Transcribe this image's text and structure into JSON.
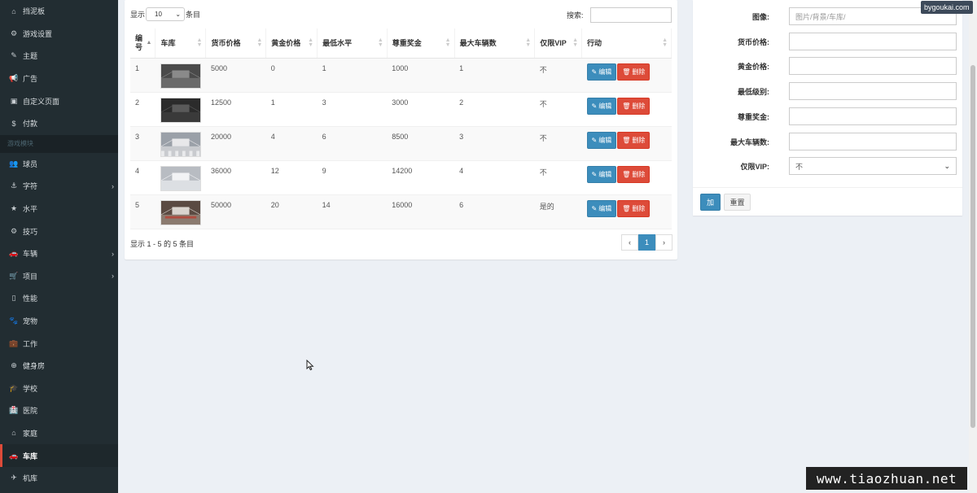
{
  "sidebar": {
    "items": [
      {
        "icon": "home-icon",
        "glyph": "⌂",
        "label": "挡泥板",
        "chevron": false
      },
      {
        "icon": "cogs-icon",
        "glyph": "⚙",
        "label": "游戏设置",
        "chevron": false
      },
      {
        "icon": "brush-icon",
        "glyph": "✎",
        "label": "主题",
        "chevron": false
      },
      {
        "icon": "bullhorn-icon",
        "glyph": "📢",
        "label": "广告",
        "chevron": false
      },
      {
        "icon": "window-icon",
        "glyph": "▣",
        "label": "自定义页面",
        "chevron": false
      },
      {
        "icon": "dollar-icon",
        "glyph": "$",
        "label": "付款",
        "chevron": false
      }
    ],
    "section_header": "游戏模块",
    "game_items": [
      {
        "icon": "users-icon",
        "glyph": "👥",
        "label": "球员",
        "chevron": false
      },
      {
        "icon": "anchor-icon",
        "glyph": "⚓",
        "label": "字符",
        "chevron": true
      },
      {
        "icon": "star-icon",
        "glyph": "★",
        "label": "水平",
        "chevron": false
      },
      {
        "icon": "gear-icon",
        "glyph": "⚙",
        "label": "技巧",
        "chevron": false
      },
      {
        "icon": "car-icon",
        "glyph": "🚗",
        "label": "车辆",
        "chevron": true
      },
      {
        "icon": "cart-icon",
        "glyph": "🛒",
        "label": "项目",
        "chevron": true
      },
      {
        "icon": "mobile-icon",
        "glyph": "▯",
        "label": "性能",
        "chevron": false
      },
      {
        "icon": "paw-icon",
        "glyph": "🐾",
        "label": "宠物",
        "chevron": false
      },
      {
        "icon": "briefcase-icon",
        "glyph": "💼",
        "label": "工作",
        "chevron": false
      },
      {
        "icon": "dumbbell-icon",
        "glyph": "⊕",
        "label": "健身房",
        "chevron": false
      },
      {
        "icon": "graduation-cap-icon",
        "glyph": "🎓",
        "label": "学校",
        "chevron": false
      },
      {
        "icon": "hospital-icon",
        "glyph": "🏥",
        "label": "医院",
        "chevron": false
      },
      {
        "icon": "house-icon",
        "glyph": "⌂",
        "label": "家庭",
        "chevron": false
      },
      {
        "icon": "car-icon",
        "glyph": "🚗",
        "label": "车库",
        "chevron": false,
        "active": true
      },
      {
        "icon": "plane-icon",
        "glyph": "✈",
        "label": "机库",
        "chevron": false
      }
    ]
  },
  "table_box": {
    "show_label": "显示",
    "page_length": "10",
    "entries_label": "条目",
    "search_label": "搜索:",
    "columns": [
      "编号",
      "车库",
      "货币价格",
      "黄金价格",
      "最低水平",
      "尊重奖金",
      "最大车辆数",
      "仅限VIP",
      "行动"
    ],
    "rows": [
      {
        "id": "1",
        "money": "5000",
        "gold": "0",
        "level": "1",
        "respect": "1000",
        "max_cars": "1",
        "vip": "不"
      },
      {
        "id": "2",
        "money": "12500",
        "gold": "1",
        "level": "3",
        "respect": "3000",
        "max_cars": "2",
        "vip": "不"
      },
      {
        "id": "3",
        "money": "20000",
        "gold": "4",
        "level": "6",
        "respect": "8500",
        "max_cars": "3",
        "vip": "不"
      },
      {
        "id": "4",
        "money": "36000",
        "gold": "12",
        "level": "9",
        "respect": "14200",
        "max_cars": "4",
        "vip": "不"
      },
      {
        "id": "5",
        "money": "50000",
        "gold": "20",
        "level": "14",
        "respect": "16000",
        "max_cars": "6",
        "vip": "是的"
      }
    ],
    "edit_label": "编辑",
    "delete_label": "删除",
    "info": "显示 1 - 5 的 5 条目",
    "pager": {
      "prev": "‹",
      "current": "1",
      "next": "›"
    }
  },
  "form": {
    "image_label": "图像:",
    "image_placeholder": "图片/背景/车库/",
    "money_label": "货币价格:",
    "gold_label": "黄金价格:",
    "min_level_label": "最低级别:",
    "respect_label": "尊重奖金:",
    "max_cars_label": "最大车辆数:",
    "vip_label": "仅限VIP:",
    "vip_value": "不",
    "add_label": "加",
    "reset_label": "重置"
  },
  "watermarks": {
    "top": "bygoukai.com",
    "bottom": "www.tiaozhuan.net"
  },
  "colors": {
    "sidebar_bg": "#222d32",
    "primary": "#3c8dbc",
    "danger": "#dd4b39",
    "content_bg": "#ecf0f5"
  }
}
